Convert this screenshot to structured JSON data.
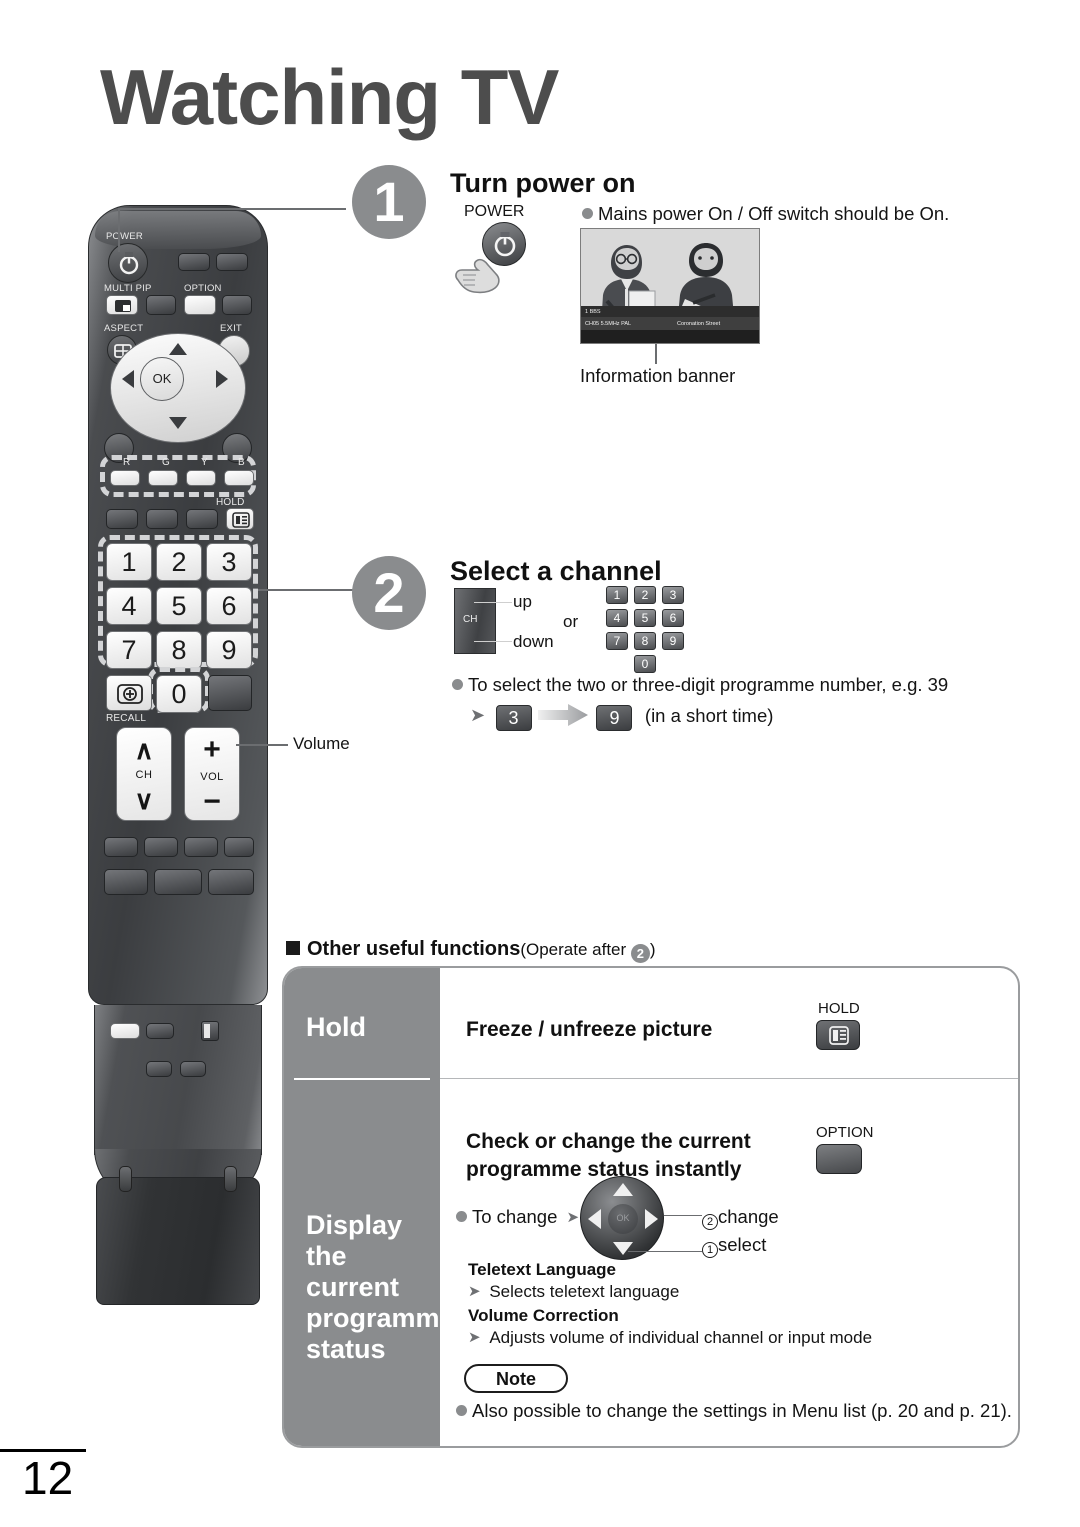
{
  "page": {
    "title": "Watching TV",
    "number": "12"
  },
  "steps": [
    {
      "num": "1",
      "heading": "Turn power on",
      "power_label": "POWER",
      "note": "Mains power On / Off switch should be On.",
      "caption": "Information banner",
      "tv_banner": {
        "channel": "1 BBS",
        "details": "CH05   5.5MHz   PAL",
        "programme": "Coronation Street"
      }
    },
    {
      "num": "2",
      "heading": "Select a channel",
      "ch_label": "CH",
      "up_label": "up",
      "down_label": "down",
      "or_label": "or",
      "keypad": [
        "1",
        "2",
        "3",
        "4",
        "5",
        "6",
        "7",
        "8",
        "9",
        "0"
      ],
      "tip": "To select the two or three-digit programme number, e.g. 39",
      "example_first": "3",
      "example_second": "9",
      "example_note": "(in a short time)"
    }
  ],
  "remote": {
    "labels": {
      "power": "POWER",
      "multi_pip": "MULTI PIP",
      "option": "OPTION",
      "aspect": "ASPECT",
      "exit": "EXIT",
      "hold": "HOLD",
      "recall": "RECALL",
      "ok": "OK",
      "ch": "CH",
      "vol": "VOL",
      "color_r": "R",
      "color_g": "G",
      "color_y": "Y",
      "color_b": "B"
    },
    "numbers": [
      "1",
      "2",
      "3",
      "4",
      "5",
      "6",
      "7",
      "8",
      "9",
      "0"
    ],
    "callouts": {
      "volume": "Volume"
    }
  },
  "other_functions": {
    "heading": "Other useful functions",
    "heading_suffix_pre": "(Operate after ",
    "heading_suffix_num": "2",
    "heading_suffix_post": ")",
    "rows": [
      {
        "left_label": "Hold",
        "title": "Freeze / unfreeze picture",
        "key_label": "HOLD"
      },
      {
        "left_label": "Display the current programme status",
        "title_line1": "Check or change the current",
        "title_line2": "programme status instantly",
        "key_label": "OPTION",
        "to_change": "To change",
        "change_num": "2",
        "change_label": "change",
        "select_num": "1",
        "select_label": "select",
        "items": [
          {
            "name": "Teletext Language",
            "desc": "Selects teletext language"
          },
          {
            "name": "Volume Correction",
            "desc": "Adjusts volume of individual channel or input mode"
          }
        ],
        "note_title": "Note",
        "note_text": "Also possible to change the settings in Menu list (p. 20 and p. 21)."
      }
    ]
  },
  "colors": {
    "title_gray": "#4d4d4d",
    "accent_gray": "#8a8c8e",
    "remote_dark": "#3b3d40"
  }
}
